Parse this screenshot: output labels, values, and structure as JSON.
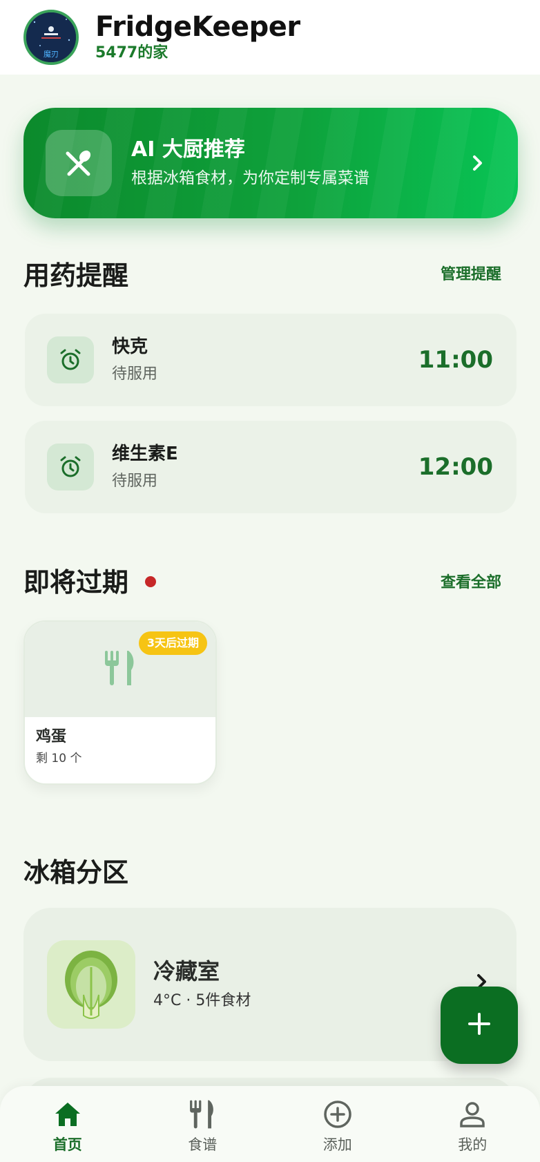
{
  "header": {
    "title": "FridgeKeeper",
    "household": "5477的家",
    "avatar_text": "魔刃"
  },
  "ai_banner": {
    "title": "AI 大厨推荐",
    "subtitle": "根据冰箱食材，为你定制专属菜谱",
    "icon": "fork-spoon-icon"
  },
  "medication": {
    "title": "用药提醒",
    "manage_label": "管理提醒",
    "items": [
      {
        "name": "快克",
        "status": "待服用",
        "time": "11:00",
        "icon": "alarm-icon"
      },
      {
        "name": "维生素E",
        "status": "待服用",
        "time": "12:00",
        "icon": "alarm-icon"
      }
    ]
  },
  "expiring": {
    "title": "即将过期",
    "view_all_label": "查看全部",
    "items": [
      {
        "name": "鸡蛋",
        "quantity": "剩 10 个",
        "badge": "3天后过期",
        "icon": "utensils-icon"
      }
    ]
  },
  "zones": {
    "title": "冰箱分区",
    "items": [
      {
        "name": "冷藏室",
        "meta": "4°C · 5件食材",
        "icon": "cabbage-icon"
      }
    ]
  },
  "fab": {
    "icon": "plus-icon"
  },
  "bottom_nav": {
    "items": [
      {
        "label": "首页",
        "icon": "home-icon",
        "active": true
      },
      {
        "label": "食谱",
        "icon": "utensils-icon",
        "active": false
      },
      {
        "label": "添加",
        "icon": "add-circle-icon",
        "active": false
      },
      {
        "label": "我的",
        "icon": "person-icon",
        "active": false
      }
    ]
  },
  "colors": {
    "primary": "#1b6e2a",
    "banner_start": "#0c8a2c",
    "banner_end": "#08c455",
    "badge": "#f6c414",
    "alert_dot": "#c62828",
    "background": "#f3f8f0"
  }
}
